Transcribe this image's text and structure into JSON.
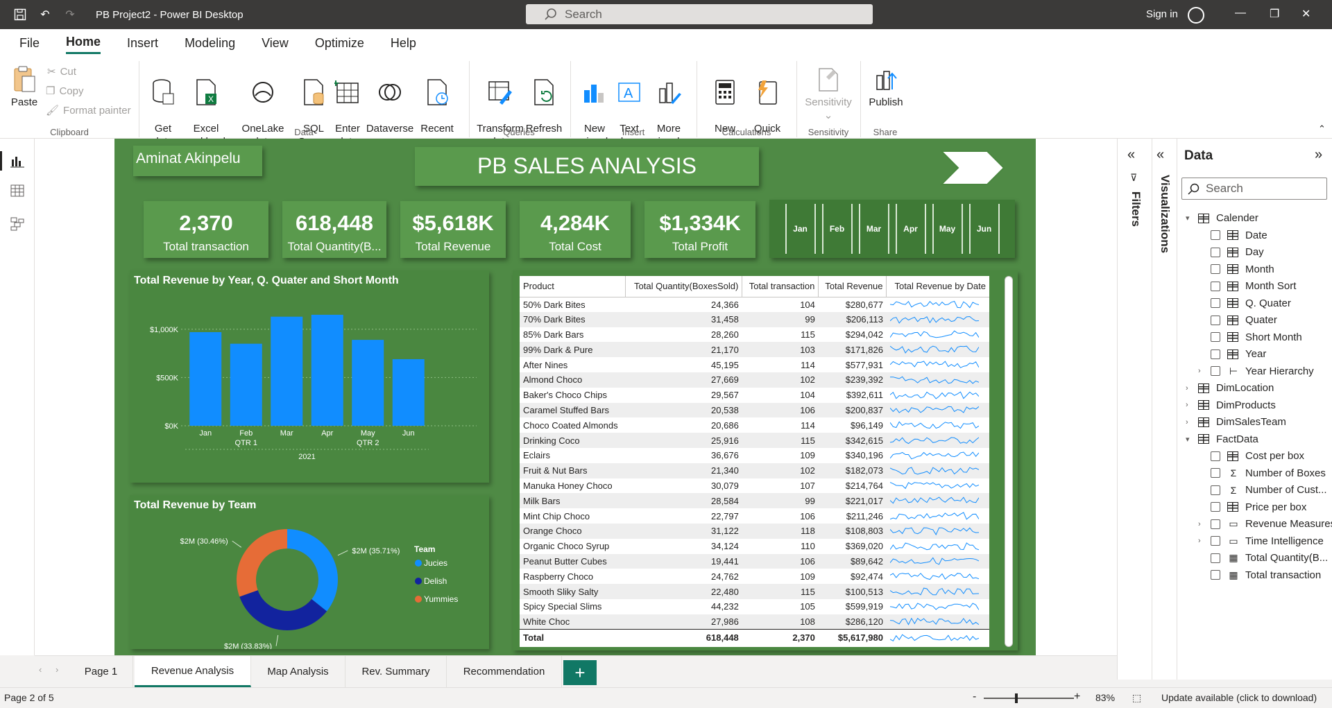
{
  "app": {
    "title": "PB Project2 - Power BI Desktop",
    "search_placeholder": "Search",
    "signin": "Sign in"
  },
  "menu": [
    "File",
    "Home",
    "Insert",
    "Modeling",
    "View",
    "Optimize",
    "Help"
  ],
  "ribbon": {
    "paste": "Paste",
    "cut": "Cut",
    "copy": "Copy",
    "format_painter": "Format painter",
    "get_data": "Get\ndata",
    "excel": "Excel\nworkbook",
    "onelake": "OneLake data\nhub",
    "sql": "SQL\nServer",
    "enter_data": "Enter\ndata",
    "dataverse": "Dataverse",
    "recent": "Recent\nsources",
    "transform": "Transform\ndata",
    "refresh": "Refresh",
    "new_visual": "New\nvisual",
    "text_box": "Text\nbox",
    "more_visuals": "More\nvisuals",
    "new_measure": "New\nmeasure",
    "quick_measure": "Quick\nmeasure",
    "sensitivity": "Sensitivity",
    "publish": "Publish",
    "groups": {
      "clipboard": "Clipboard",
      "data": "Data",
      "queries": "Queries",
      "insert": "Insert",
      "calculations": "Calculations",
      "sensitivity": "Sensitivity",
      "share": "Share"
    }
  },
  "report": {
    "author": "Aminat Akinpelu",
    "title": "PB SALES ANALYSIS",
    "kpis": [
      {
        "value": "2,370",
        "label": "Total transaction"
      },
      {
        "value": "618,448",
        "label": "Total Quantity(B..."
      },
      {
        "value": "$5,618K",
        "label": "Total Revenue"
      },
      {
        "value": "4,284K",
        "label": "Total Cost"
      },
      {
        "value": "$1,334K",
        "label": "Total Profit"
      }
    ],
    "months": [
      "Jan",
      "Feb",
      "Mar",
      "Apr",
      "May",
      "Jun"
    ],
    "bar_title": "Total Revenue by Year, Q. Quater and Short Month",
    "donut_title": "Total Revenue by Team",
    "legend_title": "Team",
    "table": {
      "headers": [
        "Product",
        "Total Quantity(BoxesSold)",
        "Total transaction",
        "Total Revenue",
        "Total Revenue by Date"
      ],
      "rows": [
        [
          "50% Dark Bites",
          "24,366",
          "104",
          "$280,677"
        ],
        [
          "70% Dark Bites",
          "31,458",
          "99",
          "$206,113"
        ],
        [
          "85% Dark Bars",
          "28,260",
          "115",
          "$294,042"
        ],
        [
          "99% Dark & Pure",
          "21,170",
          "103",
          "$171,826"
        ],
        [
          "After Nines",
          "45,195",
          "114",
          "$577,931"
        ],
        [
          "Almond Choco",
          "27,669",
          "102",
          "$239,392"
        ],
        [
          "Baker's Choco Chips",
          "29,567",
          "104",
          "$392,611"
        ],
        [
          "Caramel Stuffed Bars",
          "20,538",
          "106",
          "$200,837"
        ],
        [
          "Choco Coated Almonds",
          "20,686",
          "114",
          "$96,149"
        ],
        [
          "Drinking Coco",
          "25,916",
          "115",
          "$342,615"
        ],
        [
          "Eclairs",
          "36,676",
          "109",
          "$340,196"
        ],
        [
          "Fruit & Nut Bars",
          "21,340",
          "102",
          "$182,073"
        ],
        [
          "Manuka Honey Choco",
          "30,079",
          "107",
          "$214,764"
        ],
        [
          "Milk Bars",
          "28,584",
          "99",
          "$221,017"
        ],
        [
          "Mint Chip Choco",
          "22,797",
          "106",
          "$211,246"
        ],
        [
          "Orange Choco",
          "31,122",
          "118",
          "$108,803"
        ],
        [
          "Organic Choco Syrup",
          "34,124",
          "110",
          "$369,020"
        ],
        [
          "Peanut Butter Cubes",
          "19,441",
          "106",
          "$89,642"
        ],
        [
          "Raspberry Choco",
          "24,762",
          "109",
          "$92,474"
        ],
        [
          "Smooth Sliky Salty",
          "22,480",
          "115",
          "$100,513"
        ],
        [
          "Spicy Special Slims",
          "44,232",
          "105",
          "$599,919"
        ],
        [
          "White Choc",
          "27,986",
          "108",
          "$286,120"
        ]
      ],
      "total": [
        "Total",
        "618,448",
        "2,370",
        "$5,617,980"
      ]
    }
  },
  "chart_data": [
    {
      "type": "bar",
      "title": "Total Revenue by Year, Q. Quater and Short Month",
      "categories": [
        "Jan",
        "Feb",
        "Mar",
        "Apr",
        "May",
        "Jun"
      ],
      "quarters": [
        "QTR 1",
        "QTR 2"
      ],
      "year": "2021",
      "values": [
        970000,
        850000,
        1130000,
        1150000,
        890000,
        690000
      ],
      "yticks": [
        "$0K",
        "$500K",
        "$1,000K"
      ],
      "ylim": [
        0,
        1250000
      ],
      "color": "#118dff"
    },
    {
      "type": "pie",
      "title": "Total Revenue by Team",
      "legend_title": "Team",
      "slices": [
        {
          "name": "Jucies",
          "value": 35.71,
          "label": "$2M (35.71%)",
          "color": "#118dff"
        },
        {
          "name": "Delish",
          "value": 33.83,
          "label": "$2M (33.83%)",
          "color": "#12239e"
        },
        {
          "name": "Yummies",
          "value": 30.46,
          "label": "$2M (30.46%)",
          "color": "#e66c37"
        }
      ]
    }
  ],
  "tabs": [
    "Page 1",
    "Revenue Analysis",
    "Map Analysis",
    "Rev. Summary",
    "Recommendation"
  ],
  "add_tab": "+",
  "status": {
    "page": "Page 2 of 5",
    "zoom": "83%",
    "update": "Update available (click to download)",
    "zoom_minus": "-",
    "zoom_plus": "+"
  },
  "filters_label": "Filters",
  "visualizations_label": "Visualizations",
  "data_pane": {
    "title": "Data",
    "search_placeholder": "Search",
    "items": [
      {
        "label": "Calender",
        "kind": "table",
        "level": 0,
        "caret": "▾"
      },
      {
        "label": "Date",
        "kind": "field",
        "level": 1
      },
      {
        "label": "Day",
        "kind": "field",
        "level": 1
      },
      {
        "label": "Month",
        "kind": "field",
        "level": 1
      },
      {
        "label": "Month Sort",
        "kind": "field",
        "level": 1
      },
      {
        "label": "Q. Quater",
        "kind": "field",
        "level": 1
      },
      {
        "label": "Quater",
        "kind": "field",
        "level": 1
      },
      {
        "label": "Short Month",
        "kind": "field",
        "level": 1
      },
      {
        "label": "Year",
        "kind": "field",
        "level": 1
      },
      {
        "label": "Year Hierarchy",
        "kind": "hier",
        "level": 1,
        "caret": "›"
      },
      {
        "label": "DimLocation",
        "kind": "table",
        "level": 0,
        "caret": "›"
      },
      {
        "label": "DimProducts",
        "kind": "table",
        "level": 0,
        "caret": "›"
      },
      {
        "label": "DimSalesTeam",
        "kind": "table",
        "level": 0,
        "caret": "›"
      },
      {
        "label": "FactData",
        "kind": "table",
        "level": 0,
        "caret": "▾"
      },
      {
        "label": "Cost per box",
        "kind": "field",
        "level": 1
      },
      {
        "label": "Number of Boxes",
        "kind": "sum",
        "level": 1
      },
      {
        "label": "Number of Cust...",
        "kind": "sum",
        "level": 1
      },
      {
        "label": "Price per box",
        "kind": "field",
        "level": 1
      },
      {
        "label": "Revenue Measures",
        "kind": "folder",
        "level": 1,
        "caret": "›"
      },
      {
        "label": "Time Intelligence",
        "kind": "folder",
        "level": 1,
        "caret": "›"
      },
      {
        "label": "Total Quantity(B...",
        "kind": "measure",
        "level": 1
      },
      {
        "label": "Total transaction",
        "kind": "measure",
        "level": 1
      }
    ]
  }
}
